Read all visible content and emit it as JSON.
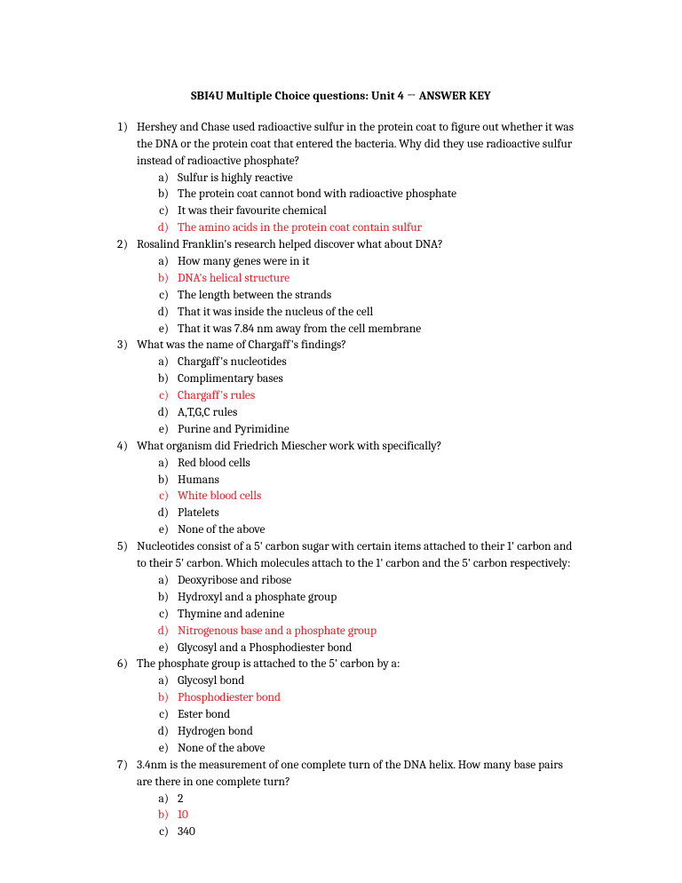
{
  "title": "SBI4U Multiple Choice questions: Unit 4 → ANSWER KEY",
  "questions": [
    {
      "stem": "Hershey and Chase used radioactive sulfur in the protein coat to figure out whether it was the DNA or the protein coat that entered the bacteria. Why did they use radioactive sulfur instead of radioactive phosphate?",
      "options": [
        {
          "text": "Sulfur is highly reactive",
          "correct": false
        },
        {
          "text": "The protein coat cannot bond with radioactive phosphate",
          "correct": false
        },
        {
          "text": "It was their favourite chemical",
          "correct": false
        },
        {
          "text": "The amino acids in the protein coat contain sulfur",
          "correct": true
        }
      ]
    },
    {
      "stem": "Rosalind Franklin's research helped discover what about DNA?",
      "options": [
        {
          "text": "How many genes were in it",
          "correct": false
        },
        {
          "text": "DNA's helical structure",
          "correct": true
        },
        {
          "text": "The length between the strands",
          "correct": false
        },
        {
          "text": "That it was inside the nucleus of the cell",
          "correct": false
        },
        {
          "text": "That it was 7.84 nm away from the cell membrane",
          "correct": false
        }
      ]
    },
    {
      "stem": "What was the name of Chargaff's findings?",
      "options": [
        {
          "text": "Chargaff's nucleotides",
          "correct": false
        },
        {
          "text": "Complimentary bases",
          "correct": false
        },
        {
          "text": "Chargaff's rules",
          "correct": true
        },
        {
          "text": "A,T,G,C rules",
          "correct": false
        },
        {
          "text": "Purine and Pyrimidine",
          "correct": false
        }
      ]
    },
    {
      "stem": "What organism did Friedrich Miescher work with specifically?",
      "options": [
        {
          "text": "Red blood cells",
          "correct": false
        },
        {
          "text": "Humans",
          "correct": false
        },
        {
          "text": "White blood cells",
          "correct": true
        },
        {
          "text": "Platelets",
          "correct": false
        },
        {
          "text": "None of the above",
          "correct": false
        }
      ]
    },
    {
      "stem": "Nucleotides consist of a 5' carbon sugar with certain items attached to their 1' carbon and to their 5' carbon. Which molecules attach to the 1' carbon and the 5' carbon respectively:",
      "options": [
        {
          "text": "Deoxyribose and ribose",
          "correct": false
        },
        {
          "text": "Hydroxyl and a phosphate group",
          "correct": false
        },
        {
          "text": "Thymine and adenine",
          "correct": false
        },
        {
          "text": "Nitrogenous base and a phosphate group",
          "correct": true
        },
        {
          "text": "Glycosyl and a Phosphodiester bond",
          "correct": false
        }
      ]
    },
    {
      "stem": "The phosphate group is attached to the 5' carbon by a:",
      "options": [
        {
          "text": "Glycosyl bond",
          "correct": false
        },
        {
          "text": "Phosphodiester bond",
          "correct": true
        },
        {
          "text": "Ester bond",
          "correct": false
        },
        {
          "text": "Hydrogen bond",
          "correct": false
        },
        {
          "text": "None of the above",
          "correct": false
        }
      ]
    },
    {
      "stem": "3.4nm is the measurement of one complete turn of the DNA helix. How many base pairs are there in one complete turn?",
      "options": [
        {
          "text": "2",
          "correct": false
        },
        {
          "text": "10",
          "correct": true
        },
        {
          "text": "340",
          "correct": false
        }
      ]
    }
  ]
}
